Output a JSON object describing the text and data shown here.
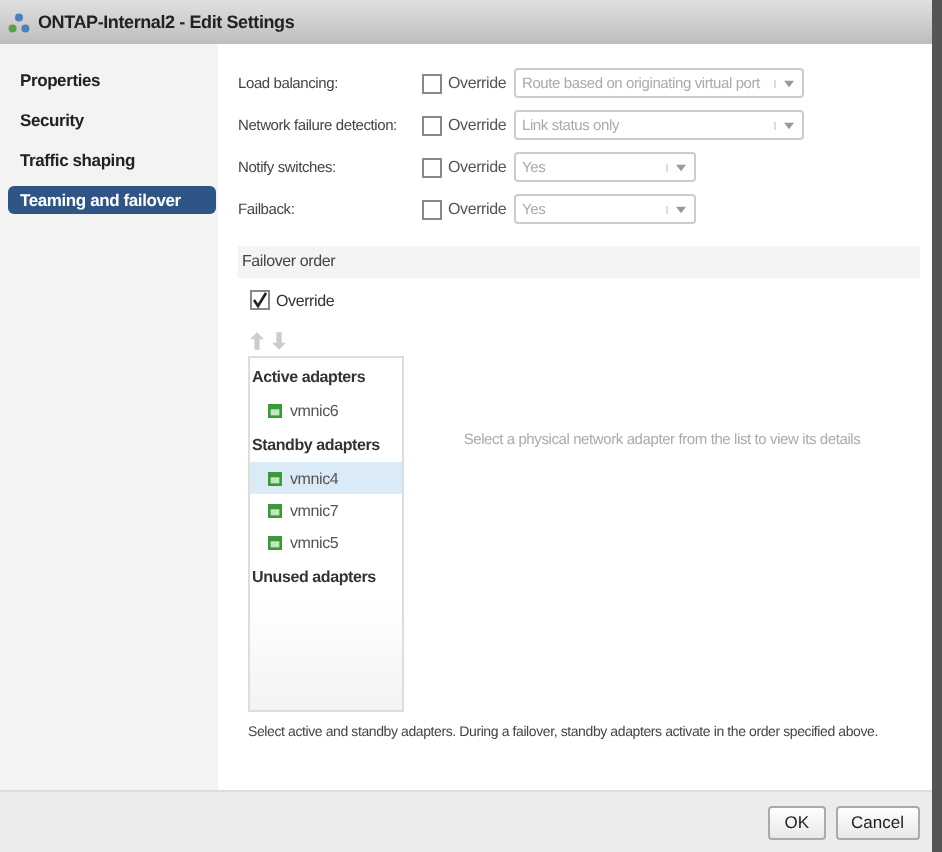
{
  "window": {
    "title": "ONTAP-Internal2 - Edit Settings"
  },
  "sidebar": {
    "items": [
      {
        "label": "Properties",
        "selected": false
      },
      {
        "label": "Security",
        "selected": false
      },
      {
        "label": "Traffic shaping",
        "selected": false
      },
      {
        "label": "Teaming and failover",
        "selected": true
      }
    ]
  },
  "settings": [
    {
      "label": "Load balancing:",
      "override": false,
      "override_label": "Override",
      "value": "Route based on originating virtual port",
      "wide": true
    },
    {
      "label": "Network failure detection:",
      "override": false,
      "override_label": "Override",
      "value": "Link status only",
      "wide": true
    },
    {
      "label": "Notify switches:",
      "override": false,
      "override_label": "Override",
      "value": "Yes",
      "wide": false
    },
    {
      "label": "Failback:",
      "override": false,
      "override_label": "Override",
      "value": "Yes",
      "wide": false
    }
  ],
  "failover": {
    "title": "Failover order",
    "override": true,
    "override_label": "Override",
    "groups": [
      {
        "title": "Active adapters",
        "adapters": [
          {
            "name": "vmnic6",
            "selected": false
          }
        ]
      },
      {
        "title": "Standby adapters",
        "adapters": [
          {
            "name": "vmnic4",
            "selected": true
          },
          {
            "name": "vmnic7",
            "selected": false
          },
          {
            "name": "vmnic5",
            "selected": false
          }
        ]
      },
      {
        "title": "Unused adapters"
      }
    ],
    "details_hint": "Select a physical network adapter from the list to view its details",
    "note": "Select active and standby adapters. During a failover, standby adapters activate in the order specified above."
  },
  "buttons": [
    "OK",
    "Cancel"
  ]
}
